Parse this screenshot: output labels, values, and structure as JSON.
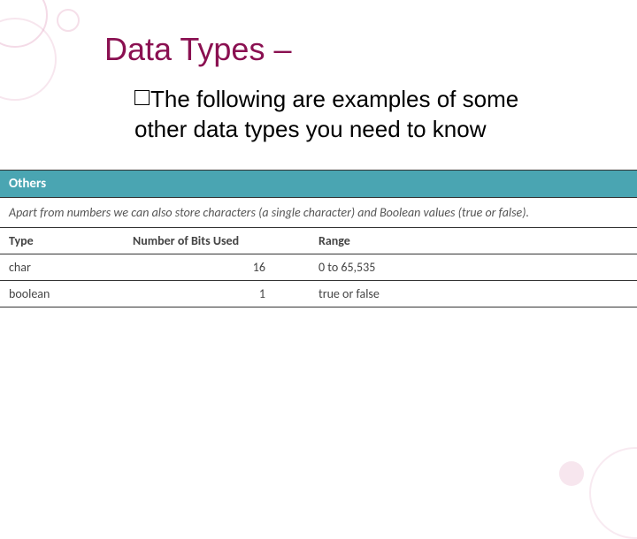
{
  "title": "Data Types –",
  "body": "The following are examples of some other data types you need to know",
  "section": {
    "header": "Others",
    "description": "Apart from numbers we can also store characters (a single character) and Boolean values (true or false)."
  },
  "table": {
    "headers": [
      "Type",
      "Number of Bits Used",
      "Range"
    ],
    "rows": [
      {
        "type": "char",
        "bits": "16",
        "range": "0 to 65,535"
      },
      {
        "type": "boolean",
        "bits": "1",
        "range": "true or false"
      }
    ]
  }
}
